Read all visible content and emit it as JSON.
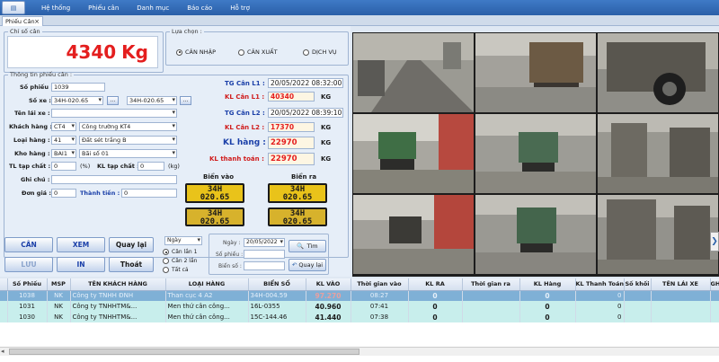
{
  "menu": {
    "app_icon": "app-menu-icon",
    "items": [
      "Hệ thống",
      "Phiếu cân",
      "Danh mục",
      "Báo cáo",
      "Hỗ trợ"
    ]
  },
  "tab": {
    "label": "Phiếu Cân",
    "close": "×"
  },
  "weight_panel": {
    "title": "Chỉ số cân",
    "value": "4340",
    "unit": "Kg"
  },
  "options": {
    "title": "Lựa chọn :",
    "radios": [
      "CÂN NHẬP",
      "CÂN XUẤT",
      "DỊCH VỤ"
    ],
    "selected": "CÂN NHẬP"
  },
  "ticket": {
    "title": "Thông tin phiếu cân :",
    "so_phieu_label": "Số phiếu :",
    "so_phieu": "1039",
    "so_xe_label": "Số xe :",
    "so_xe_1": "34H-020.65",
    "so_xe_2": "34H-020.65",
    "more": "...",
    "ten_lai_xe_label": "Tên lái xe :",
    "ten_lai_xe": "",
    "khach_hang_label": "Khách hàng :",
    "khach_hang_code": "CT4",
    "khach_hang_name": "Công trường KT4",
    "loai_hang_label": "Loại hàng :",
    "loai_hang_code": "41",
    "loai_hang_name": "Đất sét trắng B",
    "kho_hang_label": "Kho hàng :",
    "kho_hang_code": "BAI1",
    "kho_hang_name": "Bãi số 01",
    "tl_tap_chat_label": "TL tạp chất :",
    "tl_tap_chat": "0",
    "percent": "(%)",
    "kl_tap_chat_label": "KL tạp chất :",
    "kl_tap_chat": "0",
    "kg_paren": "(kg)",
    "ghi_chu_label": "Ghi chú :",
    "ghi_chu": "",
    "don_gia_label": "Đơn giá :",
    "don_gia": "0",
    "thanh_tien_label": "Thành tiền :",
    "thanh_tien": "0"
  },
  "results": {
    "tg_can_l1_label": "TG Cân L1 :",
    "tg_can_l1": "20/05/2022 08:32:00",
    "kl_can_l1_label": "KL Cân L1 :",
    "kl_can_l1": "40340",
    "tg_can_l2_label": "TG Cân L2 :",
    "tg_can_l2": "20/05/2022 08:39:10",
    "kl_can_l2_label": "KL Cân L2 :",
    "kl_can_l2": "17370",
    "kl_hang_label": "KL hàng :",
    "kl_hang": "22970",
    "kl_thanh_toan_label": "KL thanh toán :",
    "kl_thanh_toan": "22970",
    "unit": "KG"
  },
  "plates": {
    "in_title": "Biển vào",
    "out_title": "Biển ra",
    "line1": "34H",
    "line2": "020.65"
  },
  "buttons": {
    "can": "CÂN",
    "xem": "XEM",
    "quay_lai": "Quay lại",
    "luu": "LƯU",
    "in": "IN",
    "thoat": "Thoát"
  },
  "search": {
    "period": "Ngày",
    "modes": [
      "Cân lần 1",
      "Cân 2 lần",
      "Tất cả"
    ],
    "selected_mode": "Cân lần 1",
    "ngay_label": "Ngày :",
    "ngay": "20/05/2022",
    "so_phieu_label": "Số phiếu :",
    "so_phieu": "",
    "bien_so_label": "Biển số :",
    "bien_so": "",
    "tim": "Tìm",
    "quay_lai": "Quay lại"
  },
  "table": {
    "headers": [
      "Số Phiếu",
      "MSP",
      "TÊN KHÁCH HÀNG",
      "LOẠI HÀNG",
      "BIỂN SỐ",
      "KL VÀO",
      "Thời gian vào",
      "KL RA",
      "Thời gian ra",
      "KL Hàng",
      "KL Thanh Toán",
      "Số khối",
      "TÊN LÁI XE",
      "GH"
    ],
    "rows": [
      [
        "1038",
        "NK",
        "Công ty TNHH ĐNH",
        "Than cục 4 A2",
        "34H-004.59",
        "97.270",
        "08:27",
        "0",
        "",
        "0",
        "0",
        "",
        "",
        ""
      ],
      [
        "1031",
        "NK",
        "Công ty TNHHTM&...",
        "Men thứ cân công...",
        "16L-0355",
        "40.960",
        "07:41",
        "0",
        "",
        "0",
        "0",
        "",
        "",
        ""
      ],
      [
        "1030",
        "NK",
        "Công ty TNHHTM&...",
        "Men thứ cân công...",
        "15C-144.46",
        "41.440",
        "07:38",
        "0",
        "",
        "0",
        "0",
        "",
        "",
        ""
      ]
    ]
  }
}
